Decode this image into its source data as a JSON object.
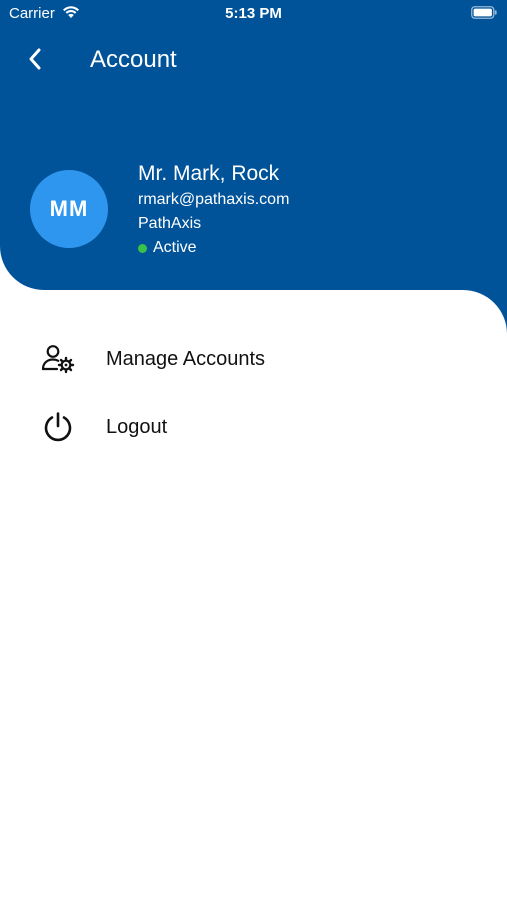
{
  "status_bar": {
    "carrier": "Carrier",
    "time": "5:13 PM"
  },
  "header": {
    "title": "Account",
    "background_color": "#005399"
  },
  "profile": {
    "initials": "MM",
    "name": "Mr. Mark, Rock",
    "email": "rmark@pathaxis.com",
    "organization": "PathAxis",
    "status": "Active",
    "status_color": "#39c24a",
    "avatar_color": "#2f96f0"
  },
  "menu": {
    "items": [
      {
        "label": "Manage Accounts",
        "icon": "user-gear-icon"
      },
      {
        "label": "Logout",
        "icon": "power-icon"
      }
    ]
  }
}
